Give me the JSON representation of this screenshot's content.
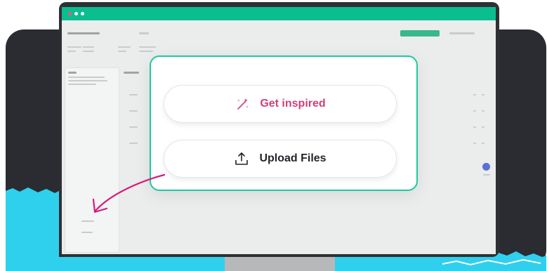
{
  "window": {
    "accent_color": "#0abe8f",
    "traffic_dots": [
      "red",
      "white",
      "white"
    ]
  },
  "modal": {
    "border_color": "#1fc9a0",
    "options": [
      {
        "label": "Get inspired",
        "icon": "magic-wand-icon",
        "color": "#d04077"
      },
      {
        "label": "Upload Files",
        "icon": "upload-icon",
        "color": "#23252a"
      }
    ]
  },
  "pointer": {
    "icon": "curved-arrow-icon",
    "color": "#d81b7a"
  }
}
